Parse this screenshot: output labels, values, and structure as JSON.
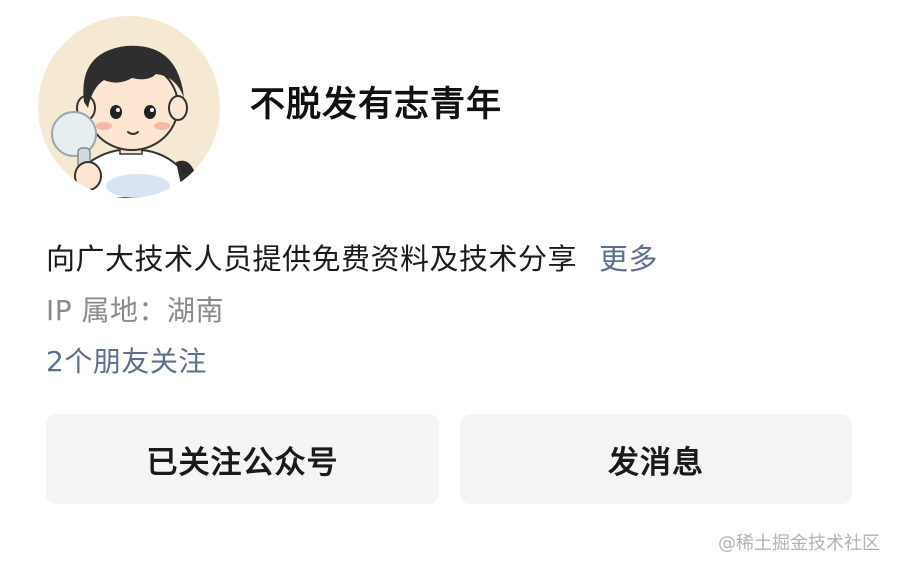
{
  "profile": {
    "name": "不脱发有志青年",
    "avatar_icon": "cartoon-boy-avatar-icon"
  },
  "intro": {
    "text": "向广大技术人员提供免费资料及技术分享",
    "more_label": "更多"
  },
  "ip_location": "IP 属地：湖南",
  "friends_follow": "2个朋友关注",
  "actions": {
    "followed_label": "已关注公众号",
    "message_label": "发消息"
  },
  "watermark": "@稀土掘金技术社区",
  "colors": {
    "link": "#5a6f93",
    "muted": "#8a8a8a",
    "button_bg": "#f5f5f5",
    "avatar_bg": "#f6e9d3"
  }
}
